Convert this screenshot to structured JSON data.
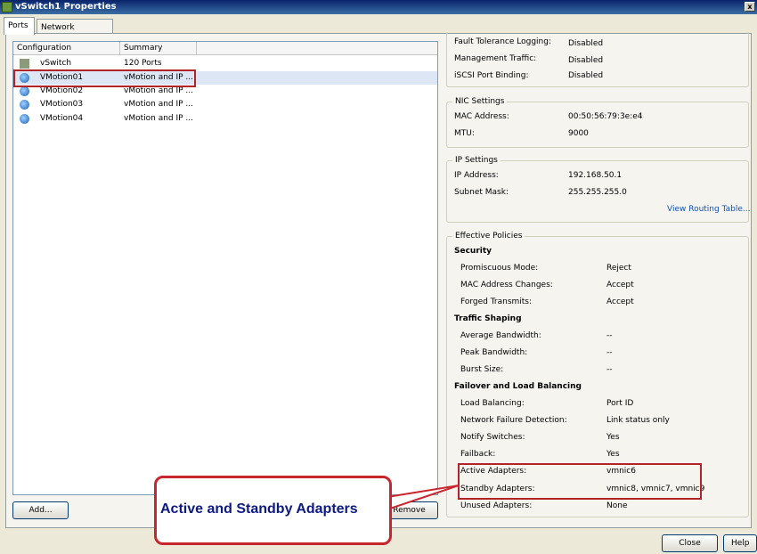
{
  "window": {
    "title": "vSwitch1 Properties",
    "close_glyph": "x"
  },
  "tabs": [
    {
      "label": "Ports",
      "active": true
    },
    {
      "label": "Network Adapters",
      "active": false
    }
  ],
  "ports_list": {
    "columns": [
      "Configuration",
      "Summary"
    ],
    "rows": [
      {
        "name": "vSwitch",
        "summary": "120 Ports",
        "icon": "switch-icon",
        "selected": false
      },
      {
        "name": "VMotion01",
        "summary": "vMotion and IP ...",
        "icon": "vmkernel-port-icon",
        "selected": true
      },
      {
        "name": "VMotion02",
        "summary": "vMotion and IP ...",
        "icon": "vmkernel-port-icon",
        "selected": false
      },
      {
        "name": "VMotion03",
        "summary": "vMotion and IP ...",
        "icon": "vmkernel-port-icon",
        "selected": false
      },
      {
        "name": "VMotion04",
        "summary": "vMotion and IP ...",
        "icon": "vmkernel-port-icon",
        "selected": false
      }
    ]
  },
  "buttons": {
    "add": "Add...",
    "remove": "Remove",
    "close": "Close",
    "help": "Help"
  },
  "port_properties": [
    {
      "label": "Fault Tolerance Logging:",
      "value": "Disabled"
    },
    {
      "label": "Management Traffic:",
      "value": "Disabled"
    },
    {
      "label": "iSCSI Port Binding:",
      "value": "Disabled"
    }
  ],
  "nic_settings": {
    "title": "NIC Settings",
    "items": [
      {
        "label": "MAC Address:",
        "value": "00:50:56:79:3e:e4"
      },
      {
        "label": "MTU:",
        "value": "9000"
      }
    ]
  },
  "ip_settings": {
    "title": "IP Settings",
    "items": [
      {
        "label": "IP Address:",
        "value": "192.168.50.1"
      },
      {
        "label": "Subnet Mask:",
        "value": "255.255.255.0"
      }
    ],
    "routing_link": "View Routing Table..."
  },
  "effective_policies": {
    "title": "Effective Policies",
    "security": {
      "heading": "Security",
      "items": [
        {
          "label": "Promiscuous Mode:",
          "value": "Reject"
        },
        {
          "label": "MAC Address Changes:",
          "value": "Accept"
        },
        {
          "label": "Forged Transmits:",
          "value": "Accept"
        }
      ]
    },
    "traffic_shaping": {
      "heading": "Traffic Shaping",
      "items": [
        {
          "label": "Average Bandwidth:",
          "value": "--"
        },
        {
          "label": "Peak Bandwidth:",
          "value": "--"
        },
        {
          "label": "Burst Size:",
          "value": "--"
        }
      ]
    },
    "failover": {
      "heading": "Failover and Load Balancing",
      "items": [
        {
          "label": "Load Balancing:",
          "value": "Port ID"
        },
        {
          "label": "Network Failure Detection:",
          "value": "Link status only"
        },
        {
          "label": "Notify Switches:",
          "value": "Yes"
        },
        {
          "label": "Failback:",
          "value": "Yes"
        },
        {
          "label": "Active Adapters:",
          "value": "vmnic6"
        },
        {
          "label": "Standby Adapters:",
          "value": "vmnic8, vmnic7, vmnic9"
        },
        {
          "label": "Unused Adapters:",
          "value": "None"
        }
      ]
    }
  },
  "annotation": {
    "callout_text": "Active and Standby Adapters",
    "highlight_color": "#b3232a"
  }
}
